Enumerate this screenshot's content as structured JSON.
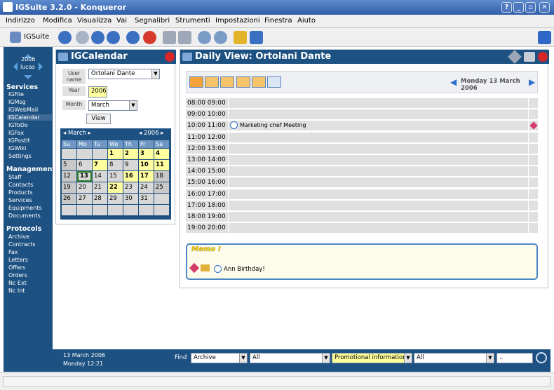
{
  "window": {
    "title": "IGSuite 3.2.0 - Konqueror",
    "buttons": [
      "?",
      "_",
      "▫",
      "✕"
    ]
  },
  "menu": [
    "Indirizzo",
    "Modifica",
    "Visualizza",
    "Vai",
    "Segnalibri",
    "Strumenti",
    "Impostazioni",
    "Finestra",
    "Aiuto"
  ],
  "toolbar": {
    "app_label": "IGSuite"
  },
  "nav": {
    "year": "2006",
    "user": "lucas",
    "services_title": "Services",
    "services": [
      "IGFile",
      "IGMsg",
      "IGWebMail",
      "IGCalendar",
      "IGToDo",
      "IGFax",
      "IGPostIt",
      "IGWiki",
      "Settings"
    ],
    "management_title": "Management",
    "management": [
      "Staff",
      "Contacts",
      "Products",
      "Services",
      "Equipments",
      "Documents"
    ],
    "protocols_title": "Protocols",
    "protocols": [
      "Archive",
      "Contracts",
      "Fax",
      "Letters",
      "Offers",
      "Orders",
      "Nc Ext",
      "Nc Int"
    ]
  },
  "calendar": {
    "title": "IGCalendar",
    "user_label": "User name",
    "user_value": "Ortolani Dante",
    "year_label": "Year",
    "year_value": "2006",
    "month_label": "Month",
    "month_value": "March",
    "view_button": "View",
    "mini": {
      "month": "March",
      "year": "2006",
      "weekdays": [
        "Su",
        "Mo",
        "Tu",
        "We",
        "Th",
        "Fr",
        "Sa"
      ],
      "weeks": [
        [
          "",
          "",
          "",
          "1",
          "2",
          "3",
          "4"
        ],
        [
          "5",
          "6",
          "7",
          "8",
          "9",
          "10",
          "11"
        ],
        [
          "12",
          "13",
          "14",
          "15",
          "16",
          "17",
          "18"
        ],
        [
          "19",
          "20",
          "21",
          "22",
          "23",
          "24",
          "25"
        ],
        [
          "26",
          "27",
          "28",
          "29",
          "30",
          "31",
          ""
        ],
        [
          "",
          "",
          "",
          "",
          "",
          "",
          ""
        ]
      ],
      "today": "13",
      "highlighted": [
        "1",
        "2",
        "3",
        "4",
        "7",
        "10",
        "11",
        "16",
        "17",
        "22"
      ]
    }
  },
  "daily": {
    "title": "Daily View: Ortolani Dante",
    "date_nav": "Monday 13 March 2006",
    "slots": [
      {
        "time": "08:00 09:00",
        "event": ""
      },
      {
        "time": "09:00 10:00",
        "event": ""
      },
      {
        "time": "10:00 11:00",
        "event": "Marketing chef Meeting"
      },
      {
        "time": "11:00 12:00",
        "event": ""
      },
      {
        "time": "12:00 13:00",
        "event": ""
      },
      {
        "time": "13:00 14:00",
        "event": ""
      },
      {
        "time": "14:00 15:00",
        "event": ""
      },
      {
        "time": "15:00 16:00",
        "event": ""
      },
      {
        "time": "16:00 17:00",
        "event": ""
      },
      {
        "time": "17:00 18:00",
        "event": ""
      },
      {
        "time": "18:00 19:00",
        "event": ""
      },
      {
        "time": "19:00 20:00",
        "event": ""
      }
    ],
    "memo_title": "Memo !",
    "memo_item": "Ann Birthday!"
  },
  "footer": {
    "date": "13 March 2006",
    "day_time": "Monday 12:21",
    "find_label": "Find",
    "select1": "Archive",
    "select2": "All",
    "select3": "Promotional information",
    "select4": "All",
    "search_value": ".."
  },
  "colors": {
    "nav_bg": "#1d5181",
    "highlight_day": "#ffffa0",
    "today_border": "#2a7d2a"
  }
}
